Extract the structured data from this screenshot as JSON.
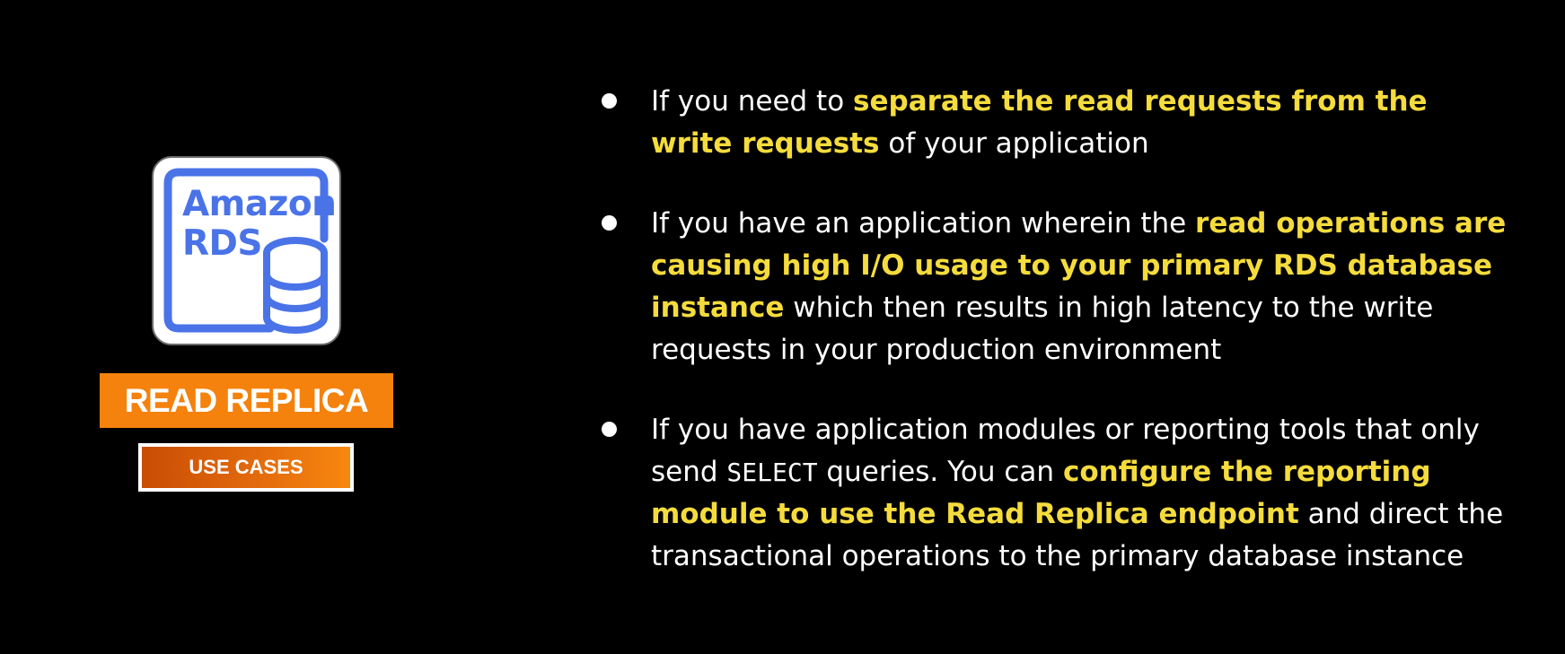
{
  "logo": {
    "line1": "Amazon",
    "line2": "RDS",
    "icon": "database-icon",
    "accent_color": "#4a73e8"
  },
  "title_badge": {
    "label": "READ REPLICA",
    "color": "#f5820c"
  },
  "subtitle_badge": {
    "label": "USE CASES"
  },
  "highlight_color": "#f5dc3c",
  "bullets": [
    {
      "a": "If you need to ",
      "b": "separate the read requests from the write requests",
      "c": " of your application"
    },
    {
      "a": "If you have an application wherein the ",
      "b": "read operations are causing high I/O usage to your primary RDS database instance",
      "c": " which then results in high latency to the write requests in your production environment"
    },
    {
      "a": "If you have application modules or reporting tools that only send ",
      "code": "SELECT",
      "a2": " queries. You can ",
      "b": "configure the reporting module to use the Read Replica endpoint",
      "c": " and direct the transactional operations to the primary database instance"
    }
  ]
}
